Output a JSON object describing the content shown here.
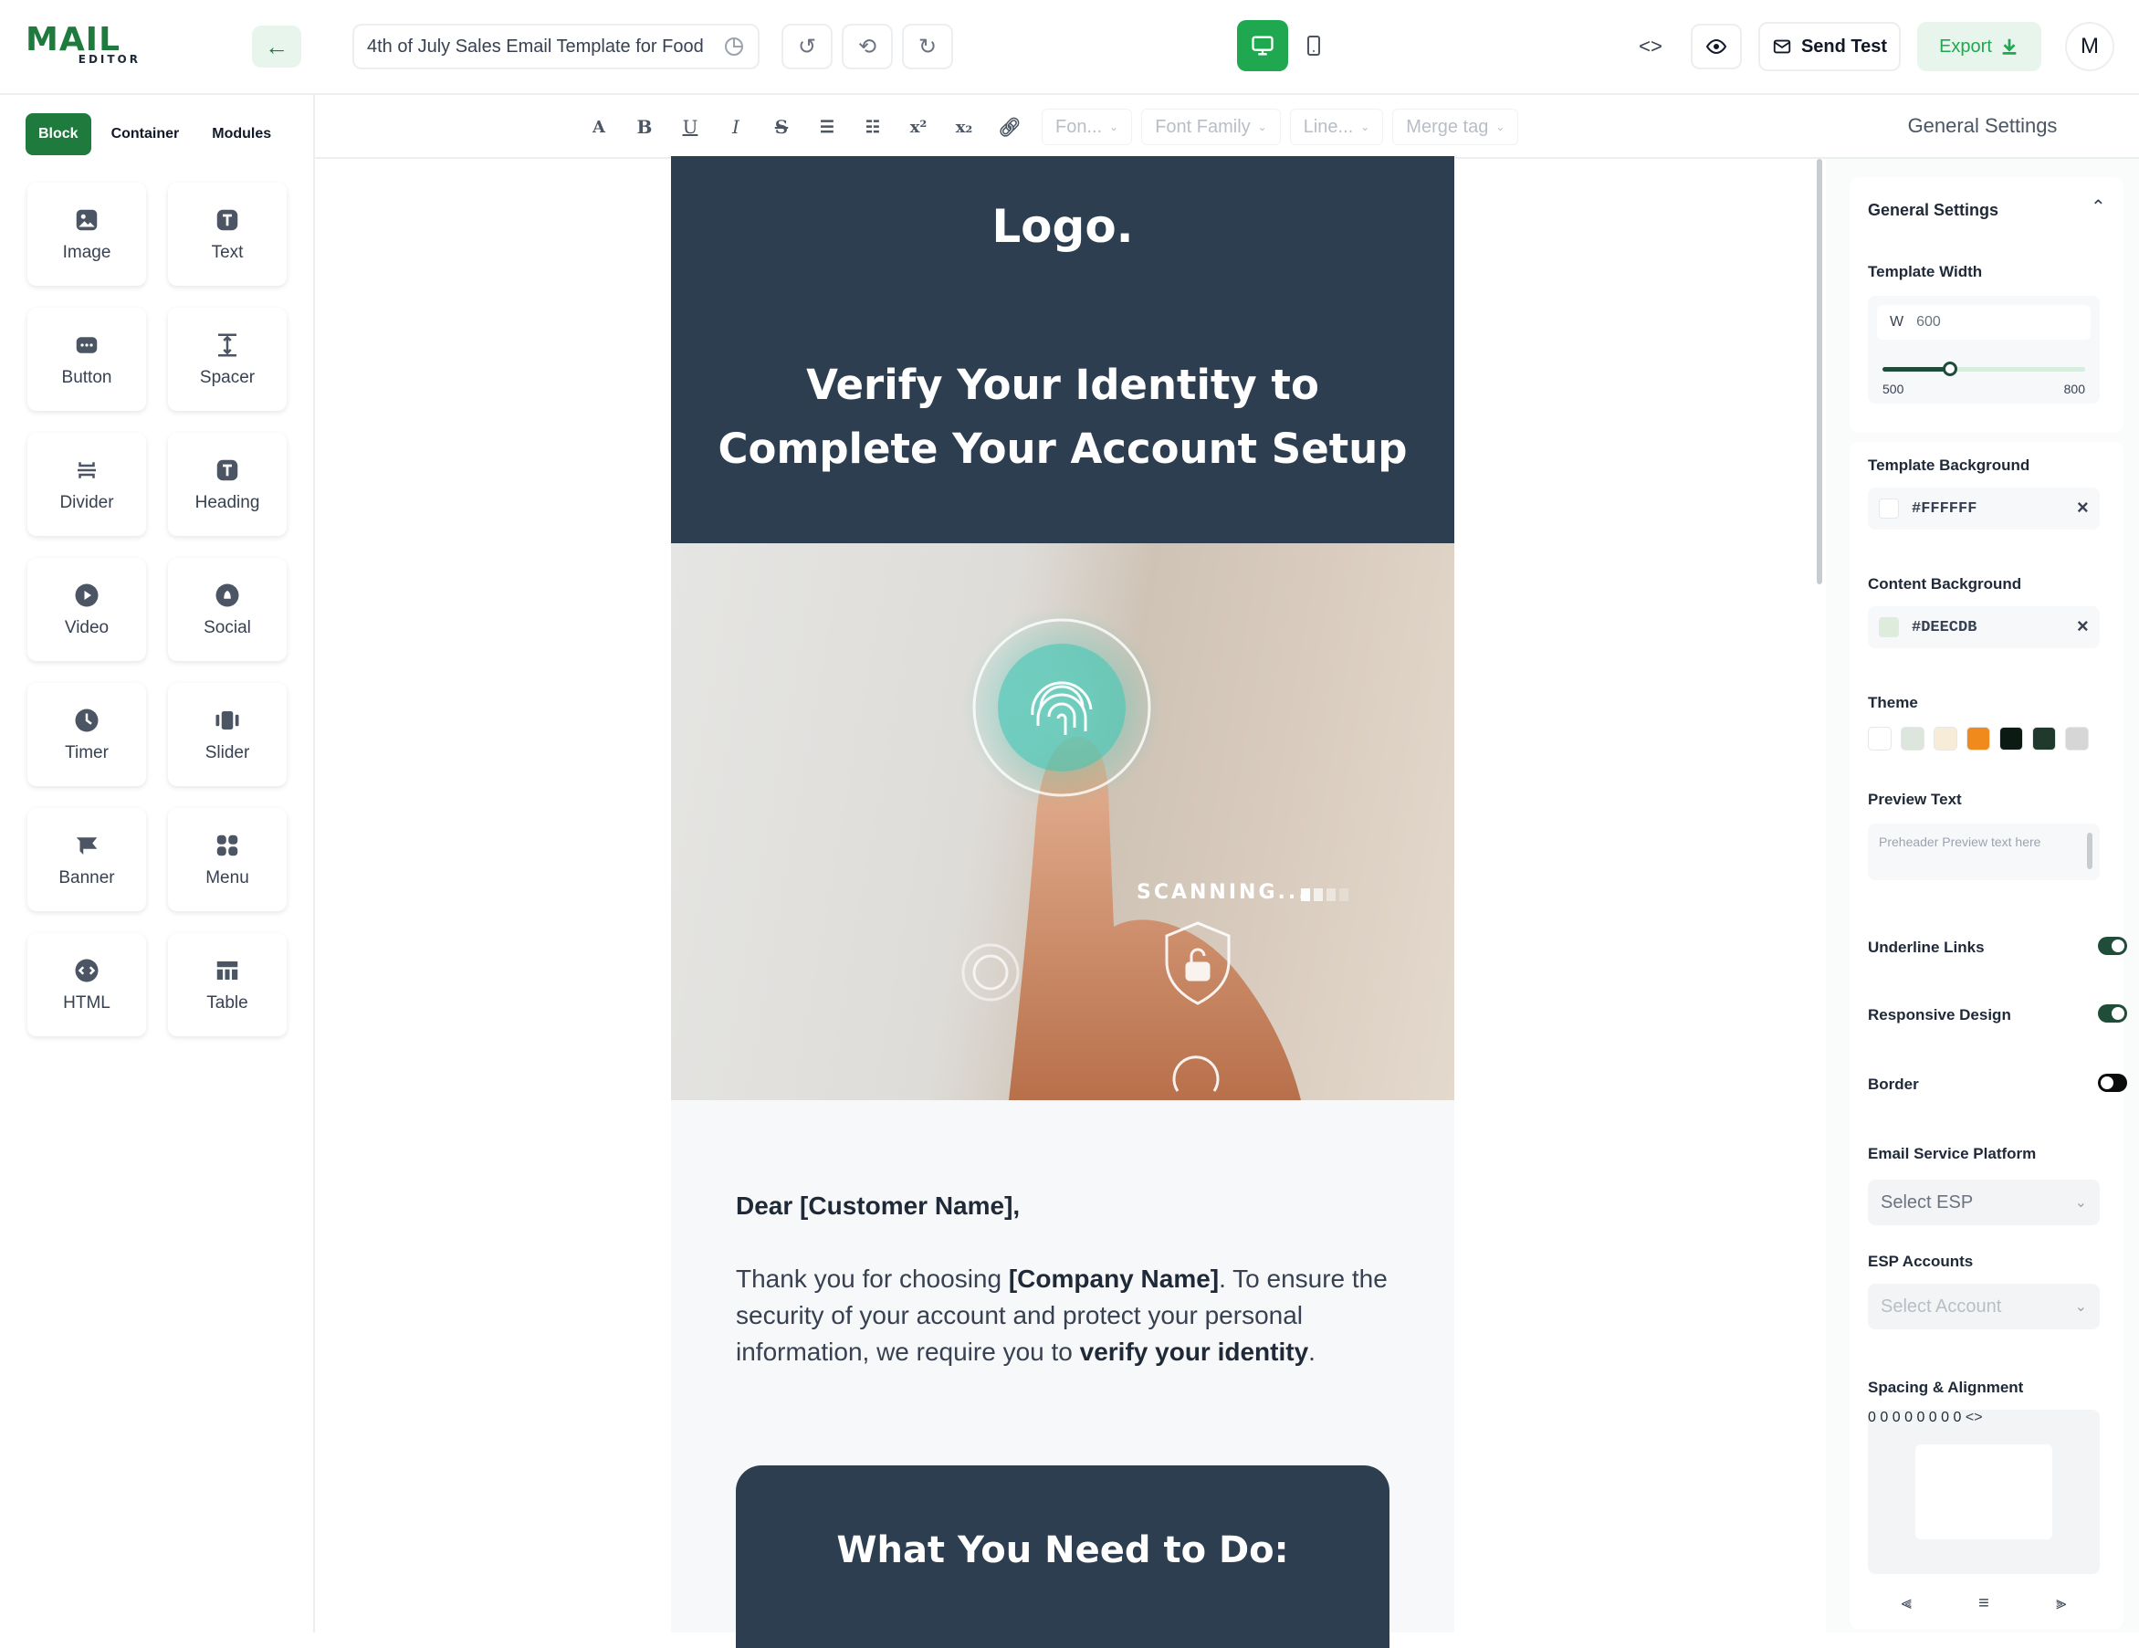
{
  "app": {
    "logo_main": "MAIL",
    "logo_sub": "EDITOR"
  },
  "header": {
    "template_title": "4th of July Sales Email Template for Food",
    "send_test_label": "Send Test",
    "export_label": "Export",
    "avatar_initial": "M"
  },
  "left_panel": {
    "tabs": [
      {
        "label": "Block",
        "active": true
      },
      {
        "label": "Container"
      },
      {
        "label": "Modules"
      }
    ],
    "blocks": [
      {
        "label": "Image",
        "icon": "image-icon"
      },
      {
        "label": "Text",
        "icon": "text-icon"
      },
      {
        "label": "Button",
        "icon": "button-icon"
      },
      {
        "label": "Spacer",
        "icon": "spacer-icon"
      },
      {
        "label": "Divider",
        "icon": "divider-icon"
      },
      {
        "label": "Heading",
        "icon": "heading-icon"
      },
      {
        "label": "Video",
        "icon": "video-icon"
      },
      {
        "label": "Social",
        "icon": "social-icon"
      },
      {
        "label": "Timer",
        "icon": "timer-icon"
      },
      {
        "label": "Slider",
        "icon": "slider-icon"
      },
      {
        "label": "Banner",
        "icon": "banner-icon"
      },
      {
        "label": "Menu",
        "icon": "menu-icon"
      },
      {
        "label": "HTML",
        "icon": "html-icon"
      },
      {
        "label": "Table",
        "icon": "table-icon"
      }
    ]
  },
  "toolbar": {
    "font_size_placeholder": "Fon...",
    "font_family_placeholder": "Font Family",
    "line_height_placeholder": "Line...",
    "merge_tag_placeholder": "Merge tag"
  },
  "email": {
    "logo_text": "Logo.",
    "headline": "Verify Your Identity to Complete Your Account Setup",
    "scanning_text": "SCANNING...",
    "greeting": "Dear [Customer Name],",
    "para_1": "Thank you for choosing ",
    "company_name": "[Company Name]",
    "para_2": ". To ensure the security of your account and protect your personal information, we require you to ",
    "verify_text": "verify your identity",
    "para_end": ".",
    "section_title": "What You Need to Do:"
  },
  "right_panel": {
    "header": "General Settings",
    "section_title": "General Settings",
    "template_width_label": "Template Width",
    "width_prefix": "W",
    "width_value": "600",
    "width_min": "500",
    "width_max": "800",
    "width_slider_value": 600,
    "template_bg_label": "Template Background",
    "template_bg_value": "#FFFFFF",
    "content_bg_label": "Content Background",
    "content_bg_value": "#DEECDB",
    "theme_label": "Theme",
    "theme_colors": [
      "#ffffff",
      "#dde6dd",
      "#f7ecd7",
      "#f08a1c",
      "#0b1a12",
      "#1f3a2c",
      "#d6d6d6"
    ],
    "preview_text_label": "Preview Text",
    "preview_text_placeholder": "Preheader Preview text here",
    "underline_links_label": "Underline Links",
    "underline_links_on": true,
    "responsive_design_label": "Responsive Design",
    "responsive_design_on": true,
    "border_label": "Border",
    "border_on": false,
    "esp_label": "Email Service Platform",
    "esp_placeholder": "Select ESP",
    "esp_accounts_label": "ESP Accounts",
    "esp_accounts_placeholder": "Select Account",
    "spacing_label": "Spacing & Alignment",
    "spacing_values": [
      "0",
      "0",
      "0",
      "0",
      "0",
      "0",
      "0",
      "0"
    ]
  }
}
